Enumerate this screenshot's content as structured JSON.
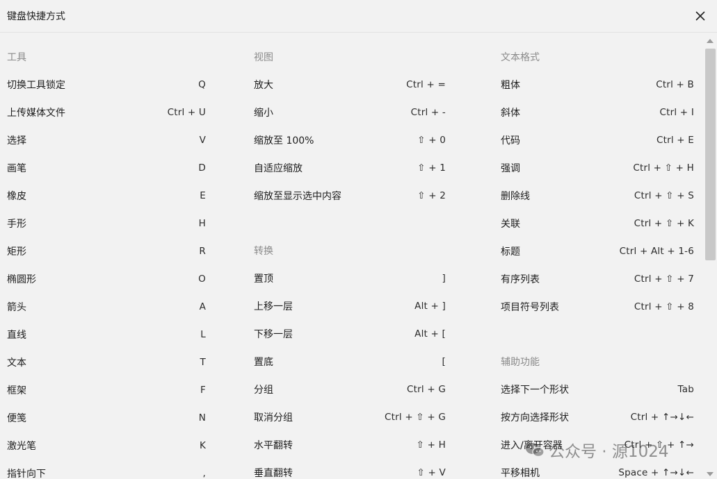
{
  "dialog": {
    "title": "键盘快捷方式",
    "close_icon": "close-icon"
  },
  "columns": [
    {
      "sections": [
        {
          "title": "工具",
          "items": [
            {
              "label": "切换工具锁定",
              "keys": "Q"
            },
            {
              "label": "上传媒体文件",
              "keys": "Ctrl + U"
            },
            {
              "label": "选择",
              "keys": "V"
            },
            {
              "label": "画笔",
              "keys": "D"
            },
            {
              "label": "橡皮",
              "keys": "E"
            },
            {
              "label": "手形",
              "keys": "H"
            },
            {
              "label": "矩形",
              "keys": "R"
            },
            {
              "label": "椭圆形",
              "keys": "O"
            },
            {
              "label": "箭头",
              "keys": "A"
            },
            {
              "label": "直线",
              "keys": "L"
            },
            {
              "label": "文本",
              "keys": "T"
            },
            {
              "label": "框架",
              "keys": "F"
            },
            {
              "label": "便笺",
              "keys": "N"
            },
            {
              "label": "激光笔",
              "keys": "K"
            },
            {
              "label": "指针向下",
              "keys": ","
            }
          ]
        }
      ]
    },
    {
      "sections": [
        {
          "title": "视图",
          "items": [
            {
              "label": "放大",
              "keys": "Ctrl + ="
            },
            {
              "label": "缩小",
              "keys": "Ctrl + -"
            },
            {
              "label": "缩放至 100%",
              "keys": "⇧ + 0"
            },
            {
              "label": "自适应缩放",
              "keys": "⇧ + 1"
            },
            {
              "label": "缩放至显示选中内容",
              "keys": "⇧ + 2"
            }
          ]
        },
        {
          "title": "转换",
          "items": [
            {
              "label": "置顶",
              "keys": "]"
            },
            {
              "label": "上移一层",
              "keys": "Alt + ]"
            },
            {
              "label": "下移一层",
              "keys": "Alt + ["
            },
            {
              "label": "置底",
              "keys": "["
            },
            {
              "label": "分组",
              "keys": "Ctrl + G"
            },
            {
              "label": "取消分组",
              "keys": "Ctrl + ⇧ + G"
            },
            {
              "label": "水平翻转",
              "keys": "⇧ + H"
            },
            {
              "label": "垂直翻转",
              "keys": "⇧ + V"
            }
          ]
        }
      ]
    },
    {
      "sections": [
        {
          "title": "文本格式",
          "items": [
            {
              "label": "粗体",
              "keys": "Ctrl + B"
            },
            {
              "label": "斜体",
              "keys": "Ctrl + I"
            },
            {
              "label": "代码",
              "keys": "Ctrl + E"
            },
            {
              "label": "强调",
              "keys": "Ctrl + ⇧ + H"
            },
            {
              "label": "删除线",
              "keys": "Ctrl + ⇧ + S"
            },
            {
              "label": "关联",
              "keys": "Ctrl + ⇧ + K"
            },
            {
              "label": "标题",
              "keys": "Ctrl + Alt + 1-6"
            },
            {
              "label": "有序列表",
              "keys": "Ctrl + ⇧ + 7"
            },
            {
              "label": "项目符号列表",
              "keys": "Ctrl + ⇧ + 8"
            }
          ]
        },
        {
          "title": "辅助功能",
          "items": [
            {
              "label": "选择下一个形状",
              "keys": "Tab"
            },
            {
              "label": "按方向选择形状",
              "keys": "Ctrl + ↑→↓←"
            },
            {
              "label": "进入/离开容器",
              "keys": "Ctrl + ⇧ + ↑→"
            },
            {
              "label": "平移相机",
              "keys": "Space + ↑→↓←"
            }
          ]
        }
      ]
    }
  ],
  "watermark": {
    "text": "公众号 · 源1024",
    "icon": "wechat-icon"
  }
}
